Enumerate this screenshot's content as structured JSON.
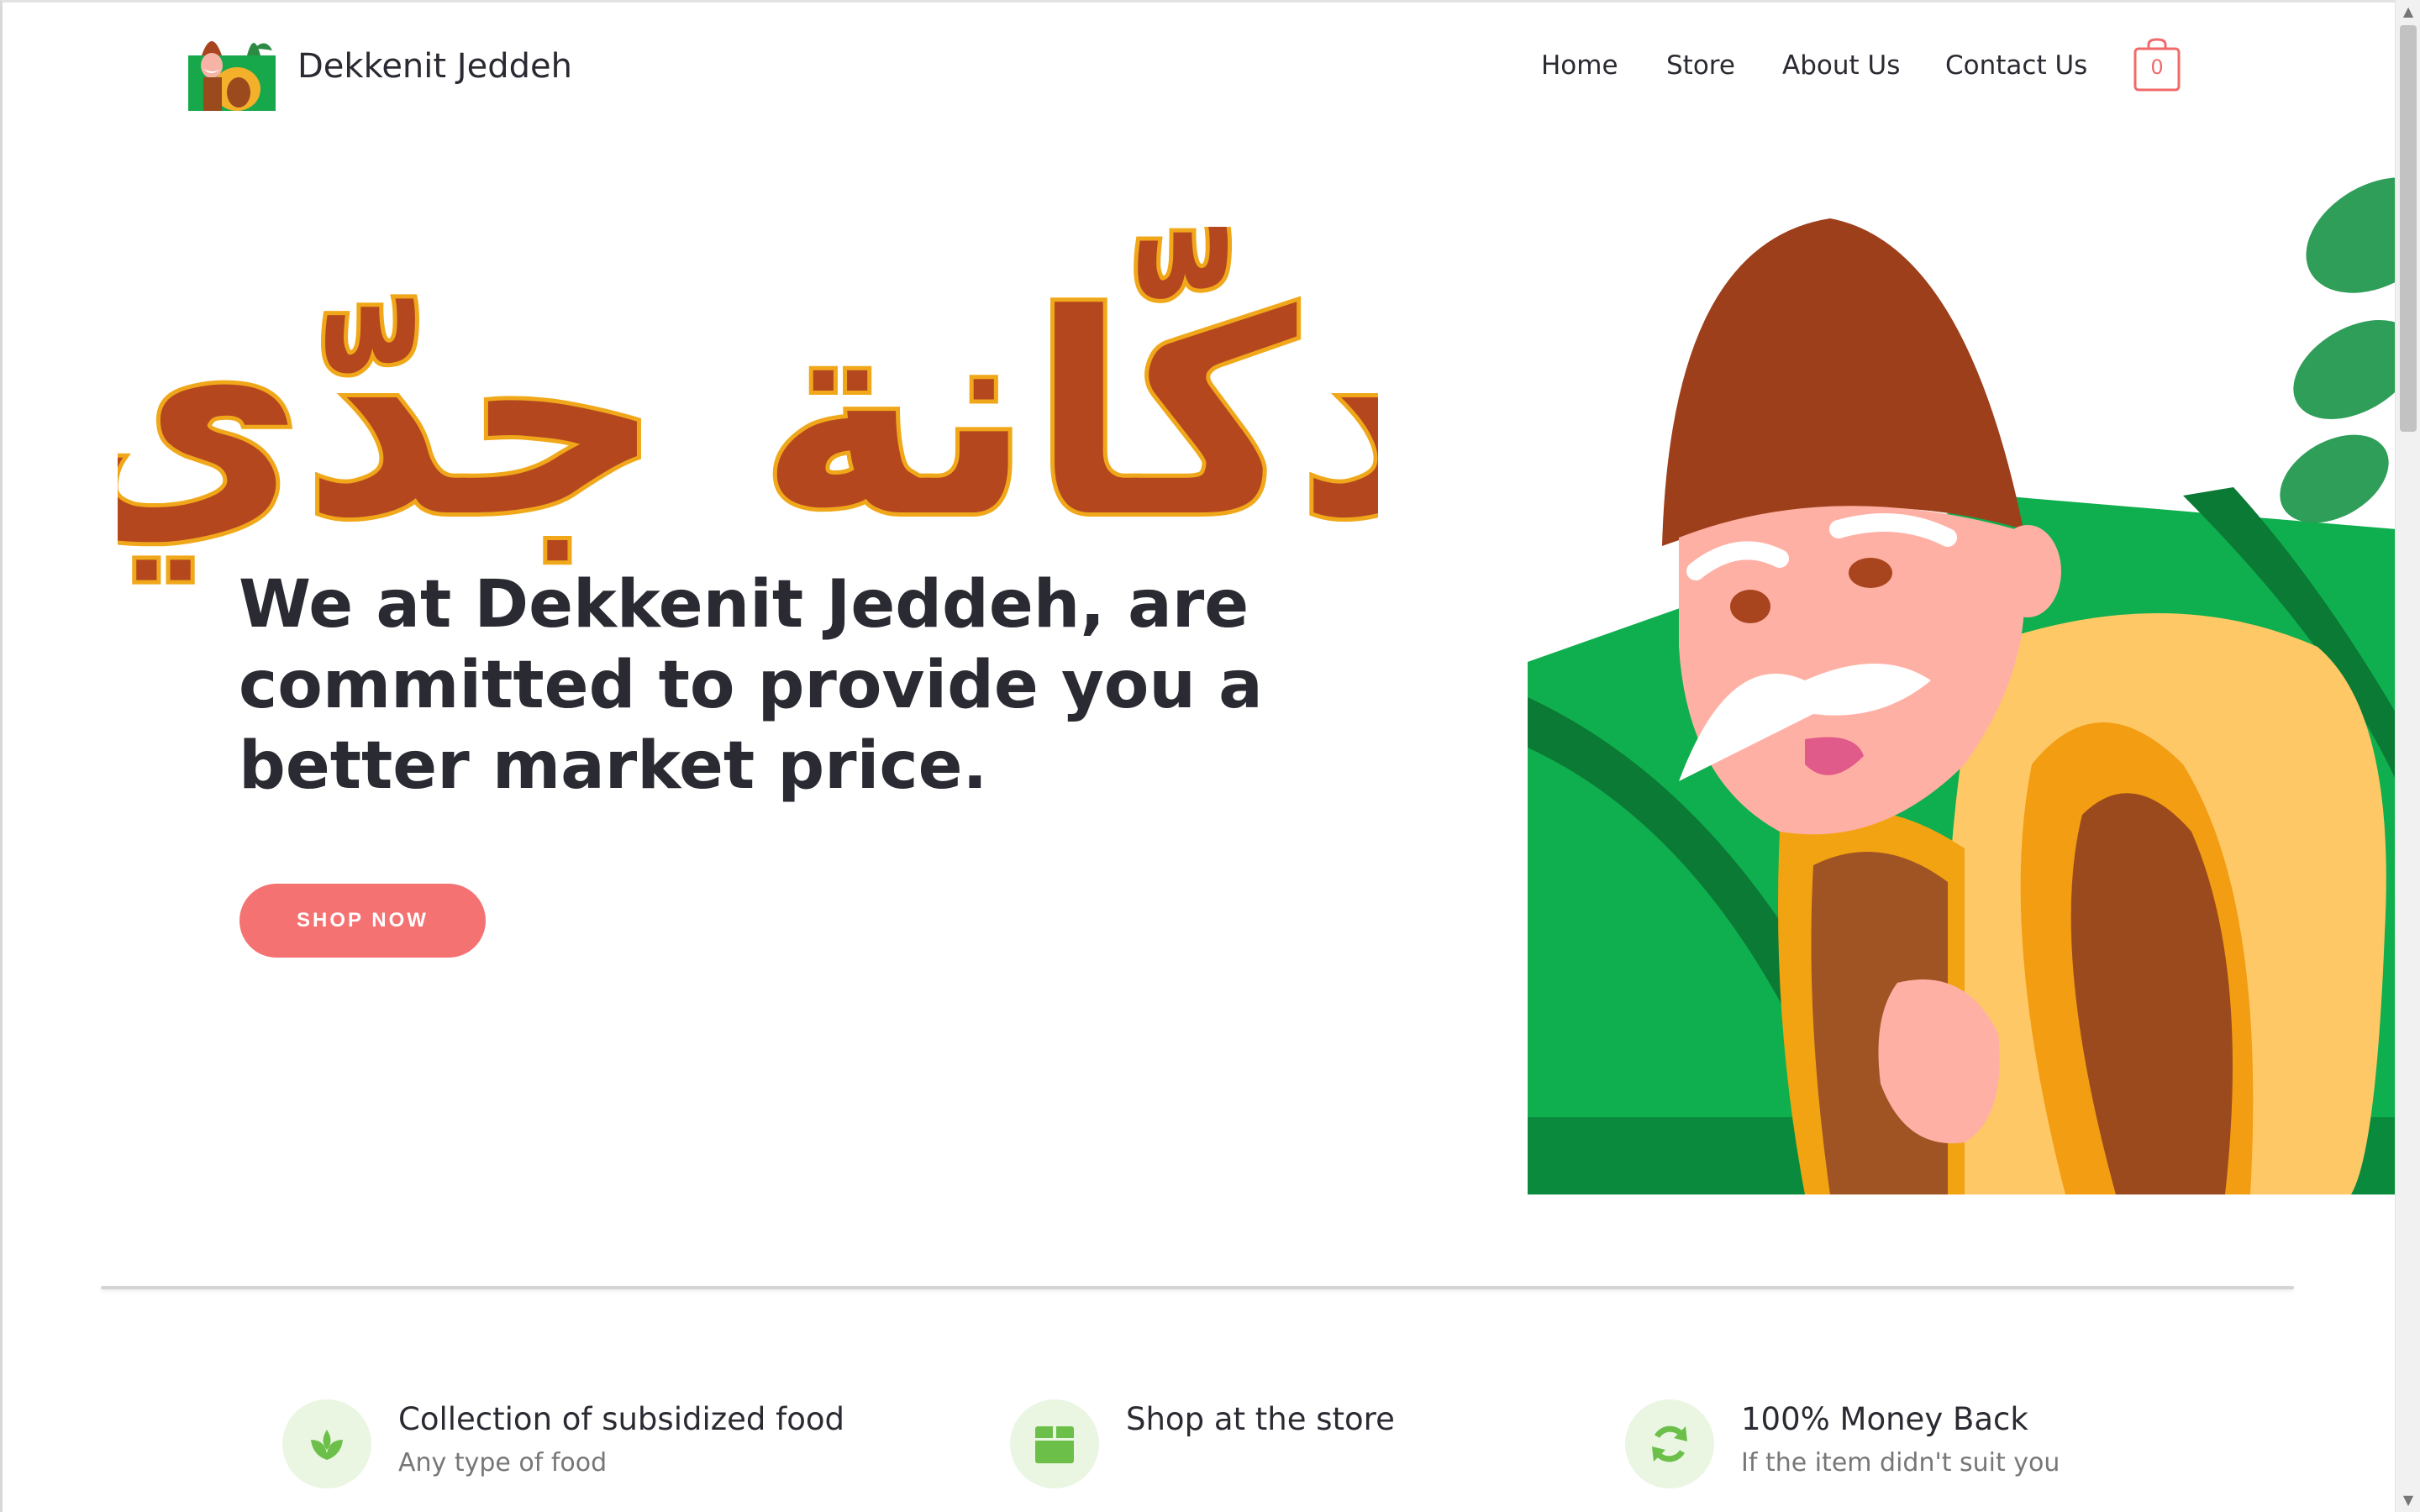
{
  "header": {
    "brand": "Dekkenit Jeddeh",
    "nav": [
      "Home",
      "Store",
      "About Us",
      "Contact Us"
    ],
    "cart_count": "0"
  },
  "hero": {
    "arabic_title": "دكّانة جدّي",
    "text": "We at Dekkenit Jeddeh, are committed to provide you a better market price.",
    "button": "SHOP NOW"
  },
  "features": [
    {
      "icon": "leaf-icon",
      "title": "Collection of subsidized food",
      "subtitle": "Any type of food"
    },
    {
      "icon": "box-icon",
      "title": "Shop at the store",
      "subtitle": ""
    },
    {
      "icon": "refresh-icon",
      "title": "100% Money Back",
      "subtitle": "If the item didn't suit you"
    }
  ],
  "colors": {
    "accent": "#f57272",
    "arabic_fill": "#b5471f",
    "arabic_outline": "#f0a81a",
    "green": "#12a84a",
    "feature_icon_bg": "#eaf6e2",
    "feature_icon": "#6cc04a"
  }
}
